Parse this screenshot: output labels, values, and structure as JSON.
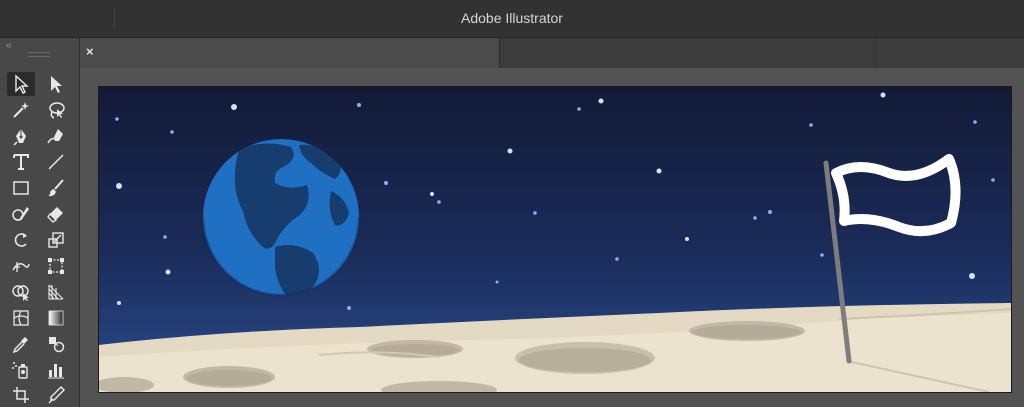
{
  "window": {
    "title": "Adobe Illustrator"
  },
  "toolbar": {
    "collapse_glyph": "‹‹",
    "tools": [
      {
        "name": "selection-tool-icon",
        "active": true
      },
      {
        "name": "direct-selection-tool-icon"
      },
      {
        "name": "magic-wand-tool-icon"
      },
      {
        "name": "lasso-tool-icon"
      },
      {
        "name": "pen-tool-icon"
      },
      {
        "name": "curvature-tool-icon"
      },
      {
        "name": "type-tool-icon",
        "glyph": "T"
      },
      {
        "name": "line-segment-tool-icon"
      },
      {
        "name": "rectangle-tool-icon"
      },
      {
        "name": "paintbrush-tool-icon"
      },
      {
        "name": "shaper-tool-icon"
      },
      {
        "name": "eraser-tool-icon"
      },
      {
        "name": "rotate-tool-icon"
      },
      {
        "name": "scale-tool-icon"
      },
      {
        "name": "width-tool-icon"
      },
      {
        "name": "free-transform-tool-icon"
      },
      {
        "name": "shape-builder-tool-icon"
      },
      {
        "name": "perspective-grid-tool-icon"
      },
      {
        "name": "mesh-tool-icon"
      },
      {
        "name": "gradient-tool-icon"
      },
      {
        "name": "eyedropper-tool-icon"
      },
      {
        "name": "blend-tool-icon"
      },
      {
        "name": "symbol-sprayer-tool-icon"
      },
      {
        "name": "column-graph-tool-icon"
      },
      {
        "name": "artboard-tool-icon"
      },
      {
        "name": "slice-tool-icon"
      }
    ]
  },
  "document_tab": {
    "close_glyph": "×"
  },
  "artwork": {
    "scene": "moon-landscape",
    "colors": {
      "sky_top": "#121a36",
      "sky_bottom": "#2a4d8e",
      "earth_ocean": "#1f6fc2",
      "earth_land": "#173c6e",
      "moon_surface": "#e4dac4",
      "crater": "#c2b8a6",
      "flag": "#ffffff",
      "pole": "#7d7d7d"
    }
  }
}
